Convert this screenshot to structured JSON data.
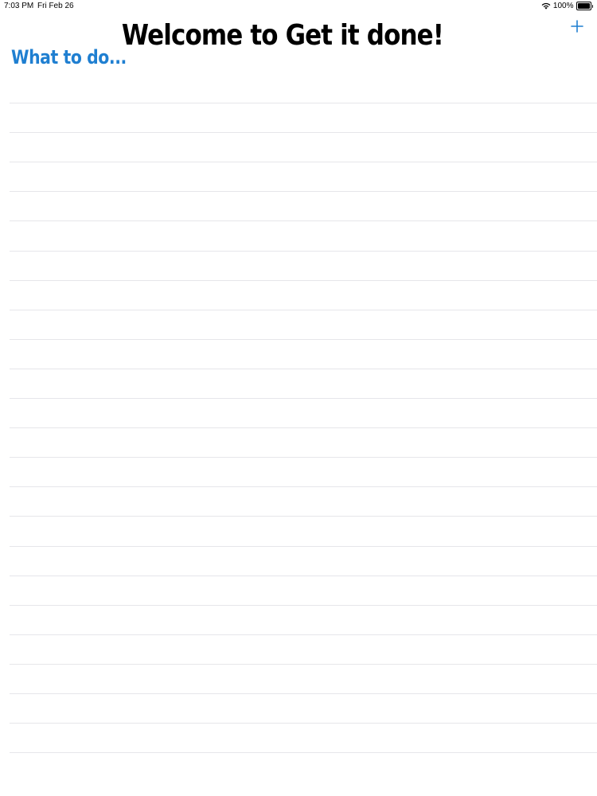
{
  "status_bar": {
    "time": "7:03 PM",
    "date": "Fri Feb 26",
    "battery_text": "100%",
    "battery_level": 1.0,
    "icons": [
      "wifi-icon",
      "battery-icon"
    ]
  },
  "header": {
    "title": "Welcome to Get it done!",
    "add_icon": "plus-icon",
    "accent_color": "#1f7fd1"
  },
  "list": {
    "subtitle": "What to do...",
    "rows": 23
  }
}
